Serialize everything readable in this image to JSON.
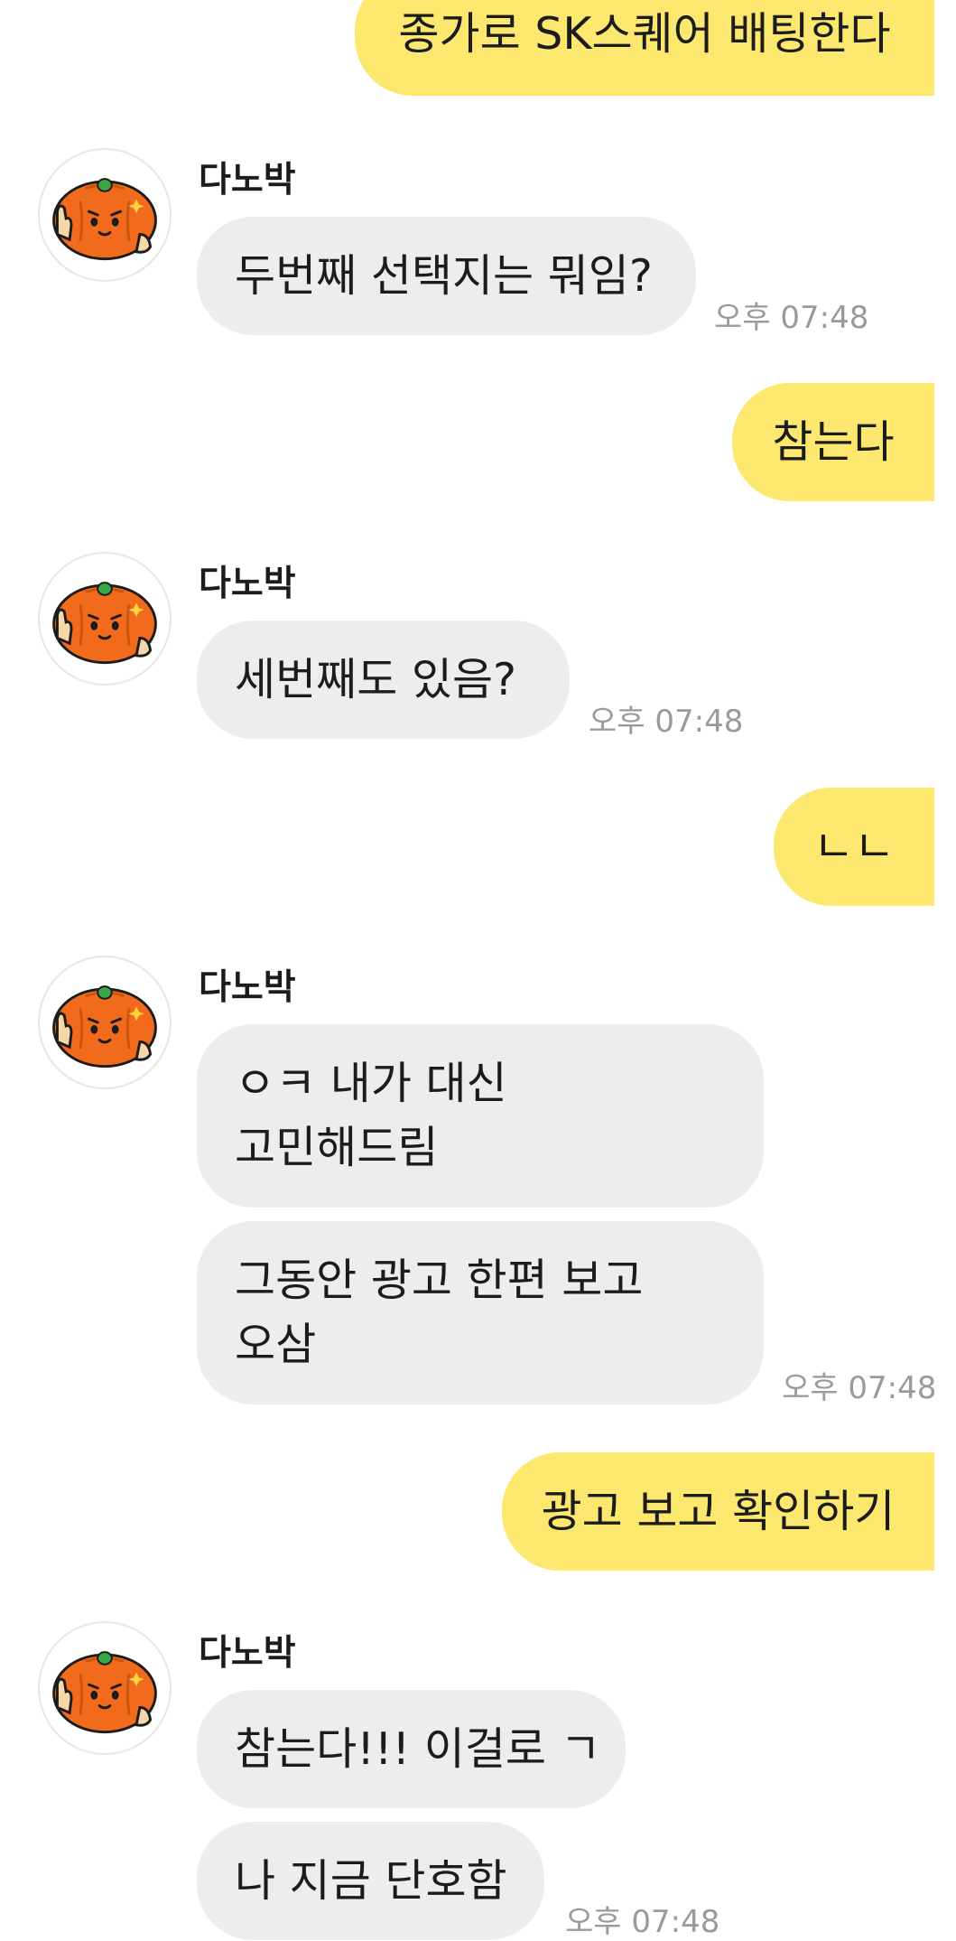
{
  "chat": {
    "sender_name": "다노박",
    "messages": [
      {
        "from": "me",
        "text": "종가로 SK스퀘어 배팅한다"
      },
      {
        "from": "bot",
        "text": "두번째 선택지는 뭐임?",
        "time": "오후 07:48"
      },
      {
        "from": "me",
        "text": "참는다"
      },
      {
        "from": "bot",
        "text": "세번째도 있음?",
        "time": "오후 07:48"
      },
      {
        "from": "me",
        "text": "ㄴㄴ"
      },
      {
        "from": "bot",
        "lines": [
          "ㅇㅋ 내가 대신",
          "고민해드림"
        ]
      },
      {
        "from": "bot",
        "lines": [
          "그동안 광고 한편 보고",
          "오삼"
        ],
        "time": "오후 07:48"
      },
      {
        "from": "me",
        "text": "광고 보고 확인하기"
      },
      {
        "from": "bot",
        "text": "참는다!!! 이걸로 ㄱ"
      },
      {
        "from": "bot",
        "text": "나 지금 단호함",
        "time": "오후 07:48"
      }
    ]
  },
  "avatar_icon": "pumpkin-character-icon",
  "colors": {
    "my_bubble": "#fde86f",
    "bot_bubble": "#ededed",
    "timestamp": "#9a9a9a",
    "pumpkin": "#f26b1d"
  }
}
